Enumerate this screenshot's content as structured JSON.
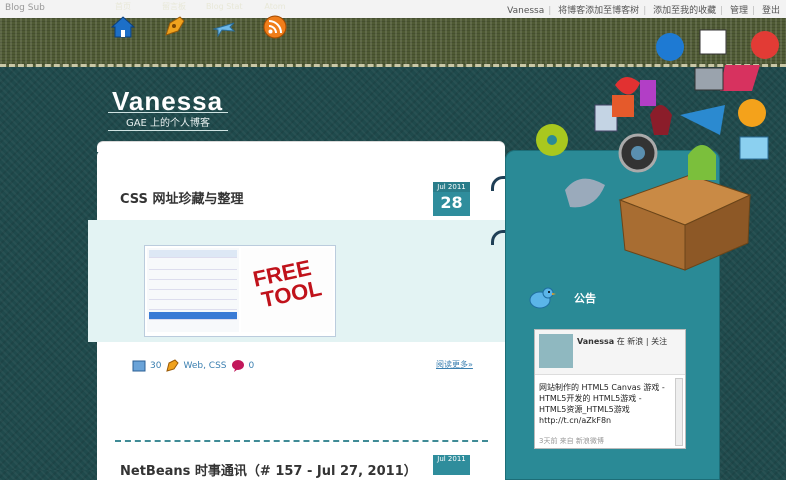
{
  "topbar": {
    "brand": "Blog Sub",
    "links": [
      "Vanessa",
      "将博客添加至博客树",
      "添加至我的收藏",
      "管理",
      "登出"
    ]
  },
  "nav": [
    {
      "label": "首页",
      "icon": "home-icon"
    },
    {
      "label": "留言板",
      "icon": "pen-icon"
    },
    {
      "label": "Blog Stat",
      "icon": "plane-icon"
    },
    {
      "label": "Atom",
      "icon": "rss-icon"
    }
  ],
  "blog": {
    "title": "Vanessa",
    "tagline": "GAE 上的个人博客"
  },
  "post1": {
    "title": "CSS 网址珍藏与整理",
    "month": "Jul 2011",
    "day": "28",
    "image_text": [
      "FREE",
      "TOOL"
    ],
    "comments_count": "30",
    "tags": "Web, CSS",
    "replies": "0",
    "read_more": "阅读更多»"
  },
  "post2": {
    "title": "NetBeans 时事通讯（# 157 - Jul 27, 2011）",
    "month": "Jul 2011"
  },
  "sidebar": {
    "heading": "公告",
    "twitter_user": "Vanessa",
    "twitter_meta": "在 新浪 | 关注",
    "tweet": "网站制作的 HTML5 Canvas 游戏 - HTML5开发的 HTML5游戏 - HTML5资源_HTML5游戏 http://t.cn/aZkF8n",
    "tweet_footer": "3天前 来自 新浪微博"
  },
  "colors": {
    "accent": "#2f8d9c",
    "header": "#4f5a34",
    "background": "#1f4a4c",
    "sidebar": "#2a8a96"
  }
}
